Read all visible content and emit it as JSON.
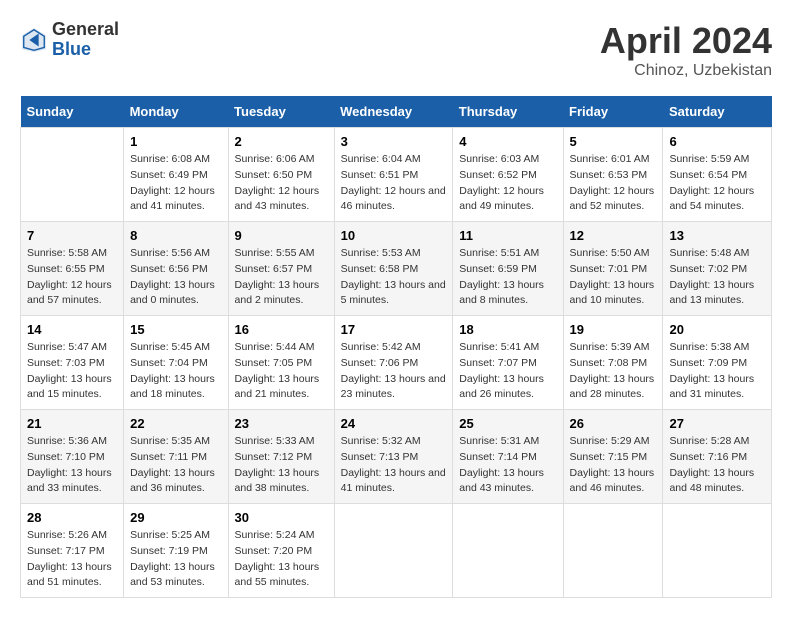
{
  "header": {
    "logo_general": "General",
    "logo_blue": "Blue",
    "month_title": "April 2024",
    "location": "Chinoz, Uzbekistan"
  },
  "weekdays": [
    "Sunday",
    "Monday",
    "Tuesday",
    "Wednesday",
    "Thursday",
    "Friday",
    "Saturday"
  ],
  "weeks": [
    [
      {
        "day": "",
        "sunrise": "",
        "sunset": "",
        "daylight": ""
      },
      {
        "day": "1",
        "sunrise": "Sunrise: 6:08 AM",
        "sunset": "Sunset: 6:49 PM",
        "daylight": "Daylight: 12 hours and 41 minutes."
      },
      {
        "day": "2",
        "sunrise": "Sunrise: 6:06 AM",
        "sunset": "Sunset: 6:50 PM",
        "daylight": "Daylight: 12 hours and 43 minutes."
      },
      {
        "day": "3",
        "sunrise": "Sunrise: 6:04 AM",
        "sunset": "Sunset: 6:51 PM",
        "daylight": "Daylight: 12 hours and 46 minutes."
      },
      {
        "day": "4",
        "sunrise": "Sunrise: 6:03 AM",
        "sunset": "Sunset: 6:52 PM",
        "daylight": "Daylight: 12 hours and 49 minutes."
      },
      {
        "day": "5",
        "sunrise": "Sunrise: 6:01 AM",
        "sunset": "Sunset: 6:53 PM",
        "daylight": "Daylight: 12 hours and 52 minutes."
      },
      {
        "day": "6",
        "sunrise": "Sunrise: 5:59 AM",
        "sunset": "Sunset: 6:54 PM",
        "daylight": "Daylight: 12 hours and 54 minutes."
      }
    ],
    [
      {
        "day": "7",
        "sunrise": "Sunrise: 5:58 AM",
        "sunset": "Sunset: 6:55 PM",
        "daylight": "Daylight: 12 hours and 57 minutes."
      },
      {
        "day": "8",
        "sunrise": "Sunrise: 5:56 AM",
        "sunset": "Sunset: 6:56 PM",
        "daylight": "Daylight: 13 hours and 0 minutes."
      },
      {
        "day": "9",
        "sunrise": "Sunrise: 5:55 AM",
        "sunset": "Sunset: 6:57 PM",
        "daylight": "Daylight: 13 hours and 2 minutes."
      },
      {
        "day": "10",
        "sunrise": "Sunrise: 5:53 AM",
        "sunset": "Sunset: 6:58 PM",
        "daylight": "Daylight: 13 hours and 5 minutes."
      },
      {
        "day": "11",
        "sunrise": "Sunrise: 5:51 AM",
        "sunset": "Sunset: 6:59 PM",
        "daylight": "Daylight: 13 hours and 8 minutes."
      },
      {
        "day": "12",
        "sunrise": "Sunrise: 5:50 AM",
        "sunset": "Sunset: 7:01 PM",
        "daylight": "Daylight: 13 hours and 10 minutes."
      },
      {
        "day": "13",
        "sunrise": "Sunrise: 5:48 AM",
        "sunset": "Sunset: 7:02 PM",
        "daylight": "Daylight: 13 hours and 13 minutes."
      }
    ],
    [
      {
        "day": "14",
        "sunrise": "Sunrise: 5:47 AM",
        "sunset": "Sunset: 7:03 PM",
        "daylight": "Daylight: 13 hours and 15 minutes."
      },
      {
        "day": "15",
        "sunrise": "Sunrise: 5:45 AM",
        "sunset": "Sunset: 7:04 PM",
        "daylight": "Daylight: 13 hours and 18 minutes."
      },
      {
        "day": "16",
        "sunrise": "Sunrise: 5:44 AM",
        "sunset": "Sunset: 7:05 PM",
        "daylight": "Daylight: 13 hours and 21 minutes."
      },
      {
        "day": "17",
        "sunrise": "Sunrise: 5:42 AM",
        "sunset": "Sunset: 7:06 PM",
        "daylight": "Daylight: 13 hours and 23 minutes."
      },
      {
        "day": "18",
        "sunrise": "Sunrise: 5:41 AM",
        "sunset": "Sunset: 7:07 PM",
        "daylight": "Daylight: 13 hours and 26 minutes."
      },
      {
        "day": "19",
        "sunrise": "Sunrise: 5:39 AM",
        "sunset": "Sunset: 7:08 PM",
        "daylight": "Daylight: 13 hours and 28 minutes."
      },
      {
        "day": "20",
        "sunrise": "Sunrise: 5:38 AM",
        "sunset": "Sunset: 7:09 PM",
        "daylight": "Daylight: 13 hours and 31 minutes."
      }
    ],
    [
      {
        "day": "21",
        "sunrise": "Sunrise: 5:36 AM",
        "sunset": "Sunset: 7:10 PM",
        "daylight": "Daylight: 13 hours and 33 minutes."
      },
      {
        "day": "22",
        "sunrise": "Sunrise: 5:35 AM",
        "sunset": "Sunset: 7:11 PM",
        "daylight": "Daylight: 13 hours and 36 minutes."
      },
      {
        "day": "23",
        "sunrise": "Sunrise: 5:33 AM",
        "sunset": "Sunset: 7:12 PM",
        "daylight": "Daylight: 13 hours and 38 minutes."
      },
      {
        "day": "24",
        "sunrise": "Sunrise: 5:32 AM",
        "sunset": "Sunset: 7:13 PM",
        "daylight": "Daylight: 13 hours and 41 minutes."
      },
      {
        "day": "25",
        "sunrise": "Sunrise: 5:31 AM",
        "sunset": "Sunset: 7:14 PM",
        "daylight": "Daylight: 13 hours and 43 minutes."
      },
      {
        "day": "26",
        "sunrise": "Sunrise: 5:29 AM",
        "sunset": "Sunset: 7:15 PM",
        "daylight": "Daylight: 13 hours and 46 minutes."
      },
      {
        "day": "27",
        "sunrise": "Sunrise: 5:28 AM",
        "sunset": "Sunset: 7:16 PM",
        "daylight": "Daylight: 13 hours and 48 minutes."
      }
    ],
    [
      {
        "day": "28",
        "sunrise": "Sunrise: 5:26 AM",
        "sunset": "Sunset: 7:17 PM",
        "daylight": "Daylight: 13 hours and 51 minutes."
      },
      {
        "day": "29",
        "sunrise": "Sunrise: 5:25 AM",
        "sunset": "Sunset: 7:19 PM",
        "daylight": "Daylight: 13 hours and 53 minutes."
      },
      {
        "day": "30",
        "sunrise": "Sunrise: 5:24 AM",
        "sunset": "Sunset: 7:20 PM",
        "daylight": "Daylight: 13 hours and 55 minutes."
      },
      {
        "day": "",
        "sunrise": "",
        "sunset": "",
        "daylight": ""
      },
      {
        "day": "",
        "sunrise": "",
        "sunset": "",
        "daylight": ""
      },
      {
        "day": "",
        "sunrise": "",
        "sunset": "",
        "daylight": ""
      },
      {
        "day": "",
        "sunrise": "",
        "sunset": "",
        "daylight": ""
      }
    ]
  ]
}
